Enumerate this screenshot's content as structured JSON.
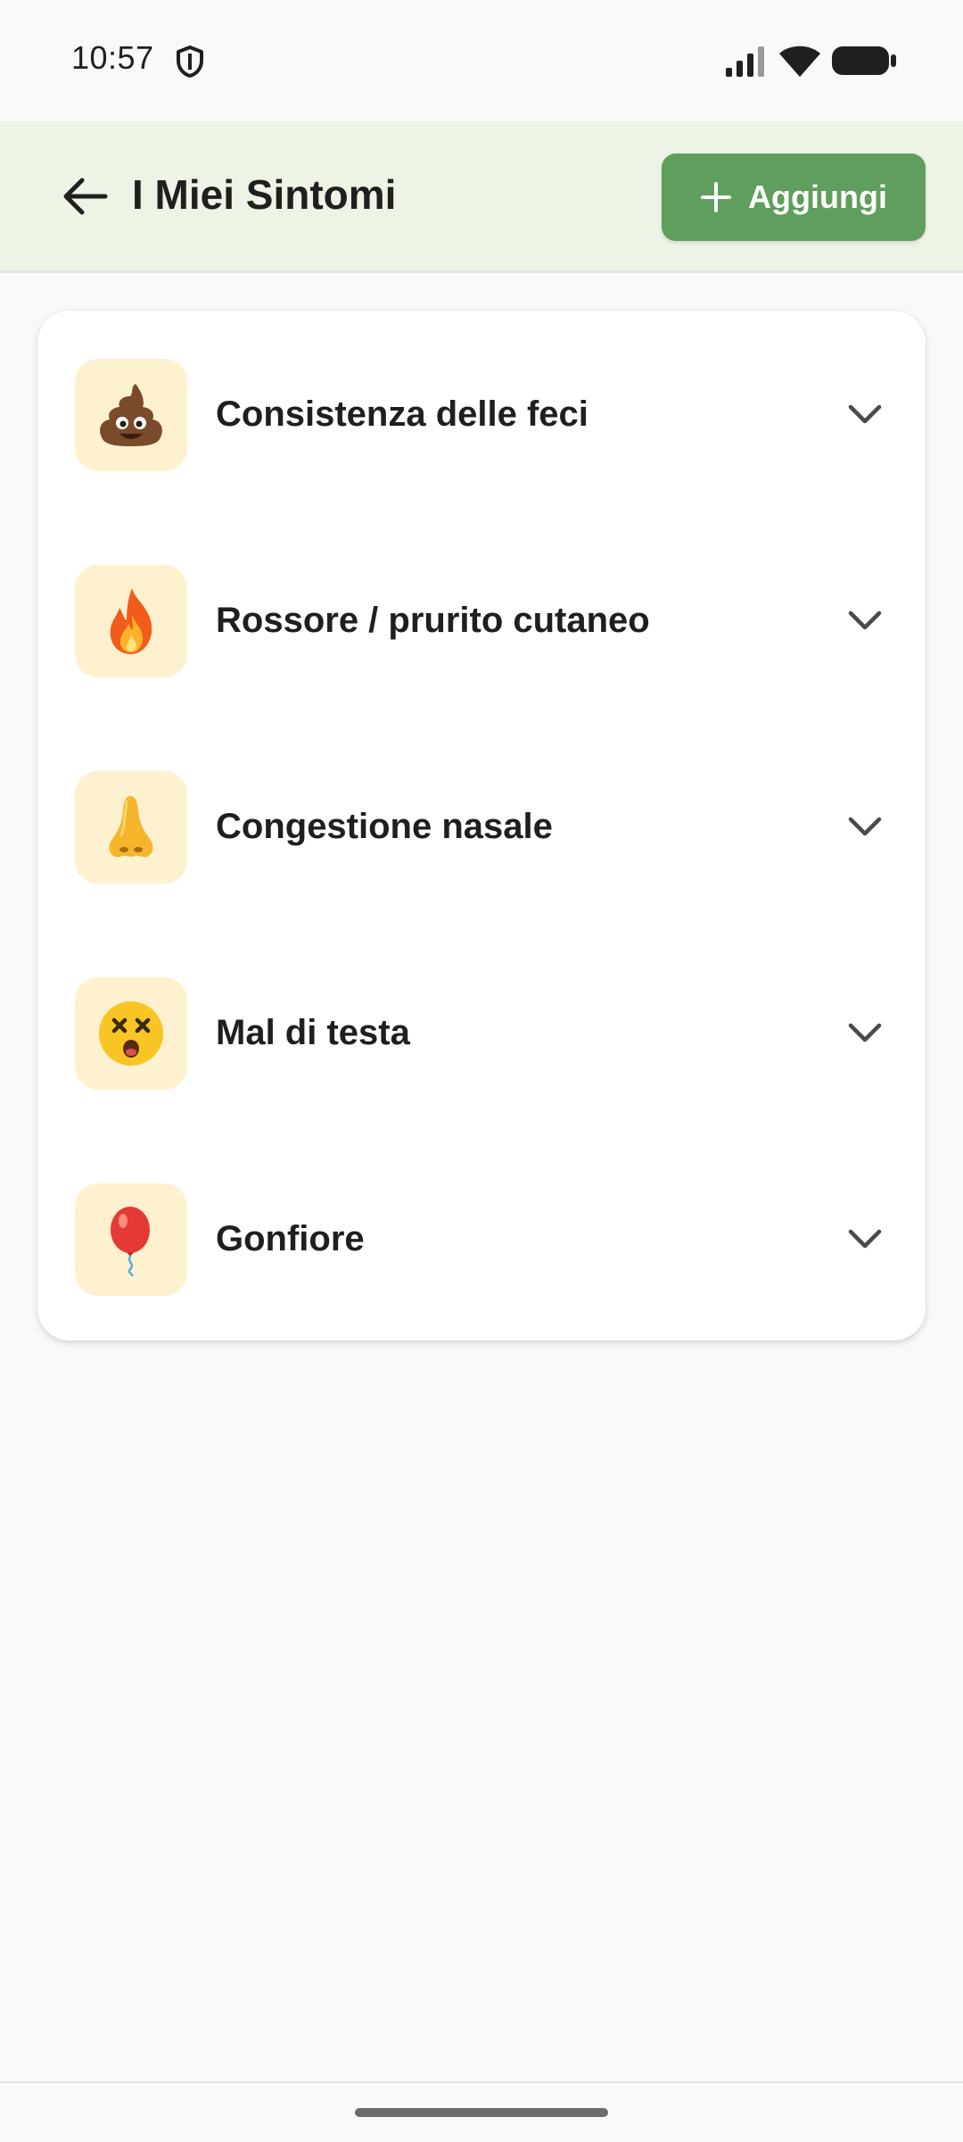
{
  "status_bar": {
    "time": "10:57",
    "icons": [
      "shield-icon",
      "signal-icon",
      "wifi-icon",
      "battery-icon"
    ]
  },
  "app_bar": {
    "title": "I Miei Sintomi",
    "back_icon": "arrow-left-icon",
    "add_button": {
      "icon": "plus-icon",
      "label": "Aggiungi"
    },
    "background_color": "#edf4e6",
    "accent_color": "#5f9e5c"
  },
  "symptoms": [
    {
      "label": "Consistenza delle feci",
      "icon": "poop-emoji-icon",
      "expanded": false
    },
    {
      "label": "Rossore / prurito cutaneo",
      "icon": "fire-emoji-icon",
      "expanded": false
    },
    {
      "label": "Congestione nasale",
      "icon": "nose-emoji-icon",
      "expanded": false
    },
    {
      "label": "Mal di testa",
      "icon": "dizzy-face-emoji-icon",
      "expanded": false
    },
    {
      "label": "Gonfiore",
      "icon": "balloon-emoji-icon",
      "expanded": false
    }
  ],
  "icon_box_color": "#fdf1cf"
}
